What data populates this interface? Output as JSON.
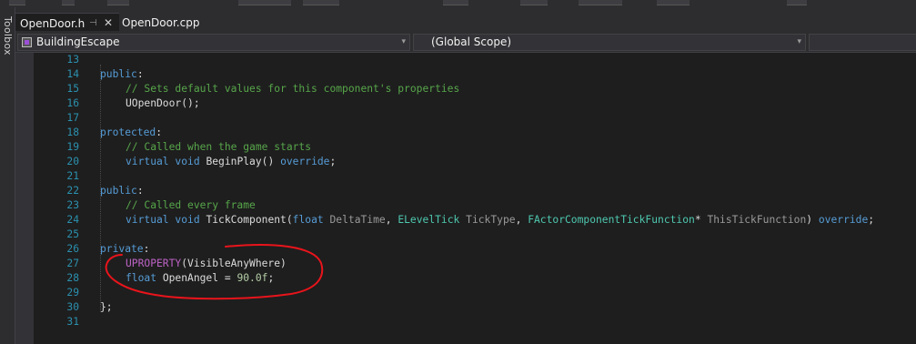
{
  "tabs": [
    {
      "name": "OpenDoor.h",
      "active": true,
      "pin_icon": "pin-icon",
      "close_icon": "close-icon"
    },
    {
      "name": "OpenDoor.cpp",
      "active": false
    }
  ],
  "sidebar": {
    "label": "Toolbox"
  },
  "navbar": {
    "project": "BuildingEscape",
    "scope": "(Global Scope)",
    "member": ""
  },
  "editor": {
    "lines": [
      {
        "n": "13",
        "indent": 0,
        "tokens": []
      },
      {
        "n": "14",
        "indent": 0,
        "tokens": [
          {
            "t": "kw",
            "v": "public"
          },
          {
            "t": "tx",
            "v": ":"
          }
        ]
      },
      {
        "n": "15",
        "indent": 1,
        "tokens": [
          {
            "t": "cm",
            "v": "// Sets default values for this component's properties"
          }
        ]
      },
      {
        "n": "16",
        "indent": 1,
        "tokens": [
          {
            "t": "tx",
            "v": "UOpenDoor();"
          }
        ]
      },
      {
        "n": "17",
        "indent": 0,
        "tokens": []
      },
      {
        "n": "18",
        "indent": 0,
        "tokens": [
          {
            "t": "kw",
            "v": "protected"
          },
          {
            "t": "tx",
            "v": ":"
          }
        ]
      },
      {
        "n": "19",
        "indent": 1,
        "tokens": [
          {
            "t": "cm",
            "v": "// Called when the game starts"
          }
        ]
      },
      {
        "n": "20",
        "indent": 1,
        "tokens": [
          {
            "t": "kw",
            "v": "virtual"
          },
          {
            "t": "tx",
            "v": " "
          },
          {
            "t": "kw",
            "v": "void"
          },
          {
            "t": "tx",
            "v": " BeginPlay() "
          },
          {
            "t": "kw",
            "v": "override"
          },
          {
            "t": "tx",
            "v": ";"
          }
        ]
      },
      {
        "n": "21",
        "indent": 0,
        "tokens": []
      },
      {
        "n": "22",
        "indent": 0,
        "tokens": [
          {
            "t": "kw",
            "v": "public"
          },
          {
            "t": "tx",
            "v": ":"
          }
        ]
      },
      {
        "n": "23",
        "indent": 1,
        "tokens": [
          {
            "t": "cm",
            "v": "// Called every frame"
          }
        ]
      },
      {
        "n": "24",
        "indent": 1,
        "tokens": [
          {
            "t": "kw",
            "v": "virtual"
          },
          {
            "t": "tx",
            "v": " "
          },
          {
            "t": "kw",
            "v": "void"
          },
          {
            "t": "tx",
            "v": " TickComponent("
          },
          {
            "t": "kw",
            "v": "float"
          },
          {
            "t": "tx",
            "v": " "
          },
          {
            "t": "prm",
            "v": "DeltaTime"
          },
          {
            "t": "tx",
            "v": ", "
          },
          {
            "t": "ty",
            "v": "ELevelTick"
          },
          {
            "t": "tx",
            "v": " "
          },
          {
            "t": "prm",
            "v": "TickType"
          },
          {
            "t": "tx",
            "v": ", "
          },
          {
            "t": "ty",
            "v": "FActorComponentTickFunction"
          },
          {
            "t": "tx",
            "v": "* "
          },
          {
            "t": "prm",
            "v": "ThisTickFunction"
          },
          {
            "t": "tx",
            "v": ") "
          },
          {
            "t": "kw",
            "v": "override"
          },
          {
            "t": "tx",
            "v": ";"
          }
        ]
      },
      {
        "n": "25",
        "indent": 0,
        "tokens": []
      },
      {
        "n": "26",
        "indent": 0,
        "tokens": [
          {
            "t": "kw",
            "v": "private"
          },
          {
            "t": "tx",
            "v": ":"
          }
        ]
      },
      {
        "n": "27",
        "indent": 1,
        "tokens": [
          {
            "t": "mac",
            "v": "UPROPERTY"
          },
          {
            "t": "tx",
            "v": "(VisibleAnyWhere)"
          }
        ]
      },
      {
        "n": "28",
        "indent": 1,
        "tokens": [
          {
            "t": "kw",
            "v": "float"
          },
          {
            "t": "tx",
            "v": " OpenAngel = "
          },
          {
            "t": "num",
            "v": "90.0f"
          },
          {
            "t": "tx",
            "v": ";"
          }
        ]
      },
      {
        "n": "29",
        "indent": 0,
        "tokens": []
      },
      {
        "n": "30",
        "indent": 0,
        "tokens": [
          {
            "t": "tx",
            "v": "};"
          }
        ]
      },
      {
        "n": "31",
        "indent": 0,
        "tokens": []
      }
    ]
  },
  "colors": {
    "keyword": "#569cd6",
    "comment": "#57a64a",
    "type": "#4ec9b0",
    "macro": "#bd63c5",
    "number": "#b5cea8",
    "parameter": "#9a9a9a",
    "line_number": "#2b91af",
    "annotation": "#e8141b"
  }
}
